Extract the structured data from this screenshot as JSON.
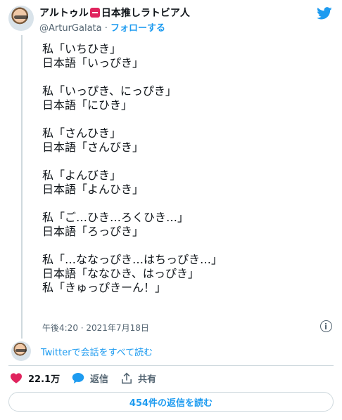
{
  "author": {
    "name_prefix": "アルトゥル",
    "name_suffix": "日本推しラトビア人",
    "handle": "@ArturGalata",
    "separator": "·",
    "follow_label": "フォローする"
  },
  "tweet": {
    "lines": [
      "私「いちひき」",
      "日本語「いっぴき」",
      "",
      "私「いっぴき、にっぴき」",
      "日本語「にひき」",
      "",
      "私「さんひき」",
      "日本語「さんびき」",
      "",
      "私「よんびき」",
      "日本語「よんひき」",
      "",
      "私「ご…ひき…ろくひき…」",
      "日本語「ろっぴき」",
      "",
      "私「…ななっぴき…はちっぴき…」",
      "日本語「ななひき、はっぴき」",
      "私「きゅっぴきーん！」"
    ],
    "timestamp": "午後4:20 · 2021年7月18日"
  },
  "conversation_link": "Twitterで会話をすべて読む",
  "actions": {
    "likes": "22.1万",
    "reply_label": "返信",
    "share_label": "共有"
  },
  "read_replies_label": "454件の返信を読む",
  "colors": {
    "accent": "#1d9bf0",
    "like": "#e0245e",
    "muted": "#536471"
  }
}
